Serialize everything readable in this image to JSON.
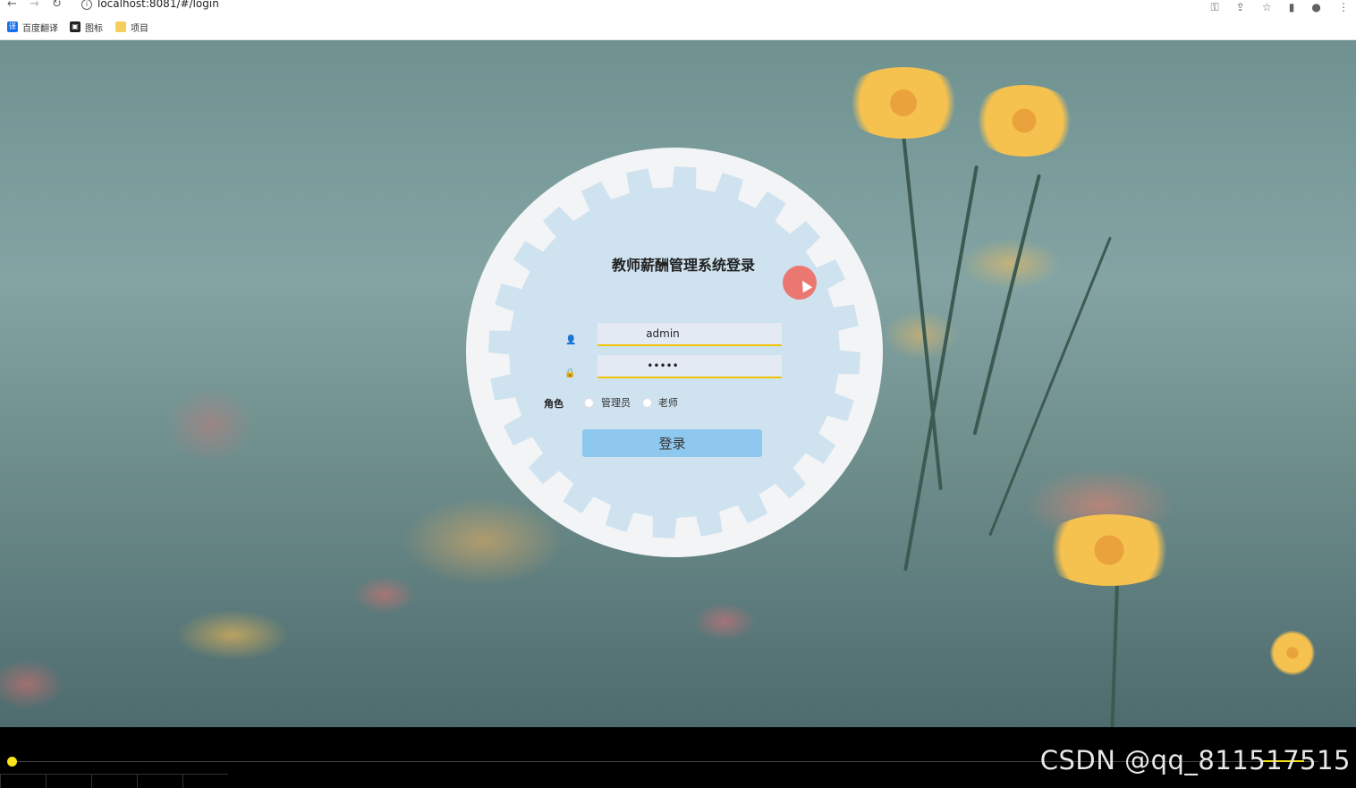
{
  "browser": {
    "url": "localhost:8081/#/login",
    "bookmarks": [
      {
        "label": "百度翻译",
        "icon": "translate-icon",
        "color": "#1a73e8"
      },
      {
        "label": "图标",
        "icon": "image-icon",
        "color": "#222222"
      },
      {
        "label": "项目",
        "icon": "folder-icon",
        "color": "#f4cf5b"
      }
    ]
  },
  "login": {
    "title": "教师薪酬管理系统登录",
    "username_value": "admin",
    "password_value": "•••••",
    "role_label": "角色",
    "roles": [
      "管理员",
      "老师"
    ],
    "submit_label": "登录"
  },
  "video": {
    "watermark": "CSDN @qq_811517515",
    "accent": "#f6e31a"
  },
  "colors": {
    "button": "#8fc8ee",
    "field_underline": "#f2c300",
    "card_inner": "#cfe2ef",
    "card_outer": "#f2f4f6"
  }
}
